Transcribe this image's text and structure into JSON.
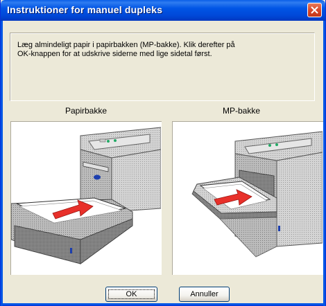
{
  "window": {
    "title": "Instruktioner for manuel dupleks"
  },
  "message": {
    "text": "Læg almindeligt papir i papirbakken  (MP-bakke). Klik derefter på\nOK-knappen for at udskrive siderne med lige sidetal først."
  },
  "pictures": {
    "left_label": "Papirbakke",
    "right_label": "MP-bakke"
  },
  "buttons": {
    "ok_label": "OK",
    "cancel_label": "Annuller"
  },
  "colors": {
    "titlebar": "#0055e5",
    "dialog_bg": "#ece9d8",
    "arrow": "#e8302a",
    "close_button": "#d8482a"
  }
}
